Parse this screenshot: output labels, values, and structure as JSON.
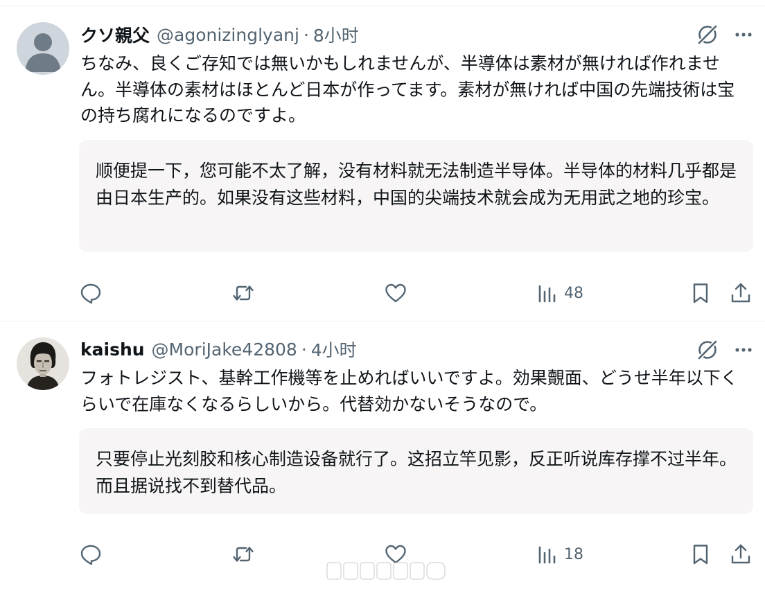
{
  "posts": [
    {
      "display_name": "クソ親父",
      "handle": "@agonizinglyanj",
      "separator": "·",
      "time": "8小时",
      "text": "ちなみ、良くご存知では無いかもしれませんが、半導体は素材が無ければ作れません。半導体の素材はほとんど日本が作ってます。素材が無ければ中国の先端技術は宝の持ち腐れになるのですよ。",
      "translation": "顺便提一下，您可能不太了解，没有材料就无法制造半导体。半导体的材料几乎都是由日本生产的。如果没有这些材料，中国的尖端技术就会成为无用武之地的珍宝。",
      "views": "48",
      "avatar_icon": "default-profile-silhouette-icon"
    },
    {
      "display_name": "kaishu",
      "handle": "@MoriJake42808",
      "separator": "·",
      "time": "4小时",
      "text": "フォトレジスト、基幹工作機等を止めればいいですよ。効果覿面、どうせ半年以下くらいで在庫なくなるらしいから。代替効かないそうなので。",
      "translation": "只要停止光刻胶和核心制造设备就行了。这招立竿见影，反正听说库存撑不过半年。而且据说找不到替代品。",
      "views": "18",
      "avatar_icon": "portrait-photo-icon"
    }
  ],
  "icons": {
    "reply": "reply-icon",
    "repost": "repost-icon",
    "like": "like-icon",
    "views": "views-icon",
    "bookmark": "bookmark-icon",
    "share": "share-icon",
    "grok": "grok-icon",
    "more": "more-icon"
  },
  "colors": {
    "text_primary": "#0f1419",
    "text_secondary": "#536471",
    "translation_bg": "#f7f5f5",
    "divider": "#eff3f4"
  }
}
